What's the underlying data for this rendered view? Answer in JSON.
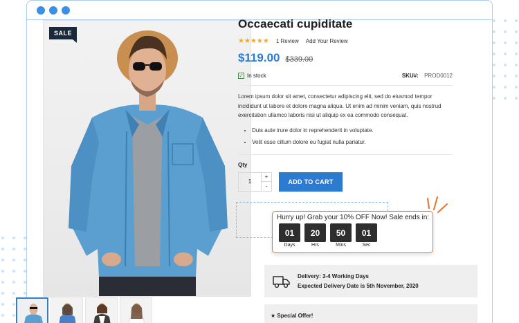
{
  "browser": {
    "dots": 3
  },
  "gallery": {
    "badge": "SALE",
    "thumbnails": [
      "thumbnail-1",
      "thumbnail-2",
      "thumbnail-3",
      "thumbnail-4"
    ],
    "active_thumbnail": 0
  },
  "product": {
    "title": "Occaecati cupiditate",
    "stars": "★★★★★",
    "rating_value": 5,
    "review_count": "1",
    "review_label": "Review",
    "add_review": "Add Your Review",
    "price": "$119.00",
    "old_price": "$339.00",
    "stock": "In stock",
    "sku_label": "SKU#:",
    "sku": "PROD0012",
    "description": "Lorem ipsum dolor sit amet, consectetur adipiscing elit, sed do eiusmod tempor incididunt ut labore et dolore magna aliqua. Ut enim ad minim veniam, quis nostrud exercitation ullamco laboris nisi ut aliquip ex ea commodo consequat.",
    "bullets": [
      "Duis aute irure dolor in reprehenderit in voluptate.",
      "Velit esse cillum dolore eu fugiat nulla pariatur."
    ]
  },
  "cart": {
    "qty_label": "Qty",
    "qty_value": "1",
    "plus": "+",
    "minus": "-",
    "add_to_cart": "ADD TO CART"
  },
  "promo": {
    "text": "Hurry up! Grab your 10% OFF Now! Sale ends in:",
    "timers": [
      {
        "value": "01",
        "label": "Days"
      },
      {
        "value": "20",
        "label": "Hrs"
      },
      {
        "value": "50",
        "label": "Mins"
      },
      {
        "value": "01",
        "label": "Sec"
      }
    ]
  },
  "delivery": {
    "line1": "Delivery: 3-4 Working Days",
    "line2": "Expected Delivery Date is 5th November, 2020"
  },
  "special": {
    "text": "★ Special Offer!"
  },
  "colors": {
    "accent": "#2b7bd0",
    "promo_border": "#e5793a",
    "badge": "#1b2a3a",
    "star": "#f0a92e",
    "browser_border": "#a9cdf0"
  }
}
